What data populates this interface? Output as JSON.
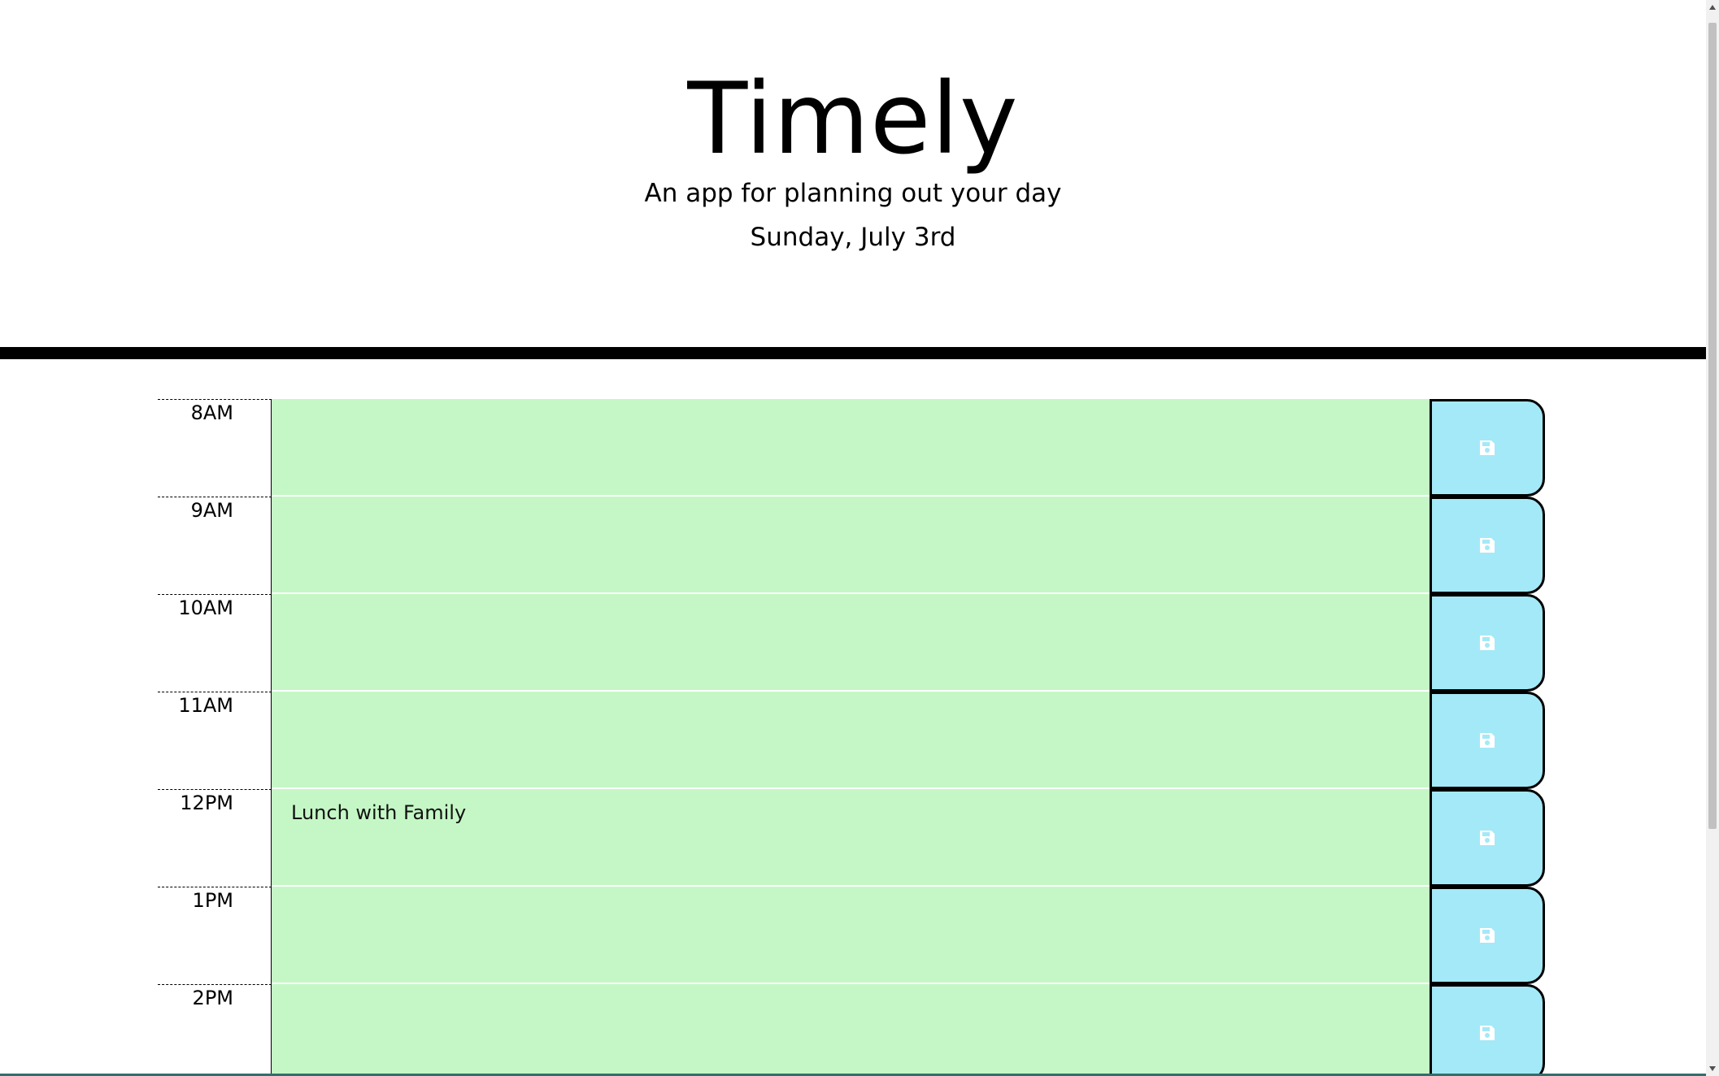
{
  "app": {
    "title": "Timely",
    "subtitle": "An app for planning out your day",
    "current_day": "Sunday, July 3rd"
  },
  "colors": {
    "present_future_block": "#c4f7c5",
    "save_button": "#a4e9f7",
    "header_rule": "#000000"
  },
  "schedule": {
    "blocks": [
      {
        "hour": "8AM",
        "text": "",
        "save_icon": "floppy-disk-icon"
      },
      {
        "hour": "9AM",
        "text": "",
        "save_icon": "floppy-disk-icon"
      },
      {
        "hour": "10AM",
        "text": "",
        "save_icon": "floppy-disk-icon"
      },
      {
        "hour": "11AM",
        "text": "",
        "save_icon": "floppy-disk-icon"
      },
      {
        "hour": "12PM",
        "text": "Lunch with Family",
        "save_icon": "floppy-disk-icon"
      },
      {
        "hour": "1PM",
        "text": "",
        "save_icon": "floppy-disk-icon"
      },
      {
        "hour": "2PM",
        "text": "",
        "save_icon": "floppy-disk-icon"
      }
    ]
  }
}
